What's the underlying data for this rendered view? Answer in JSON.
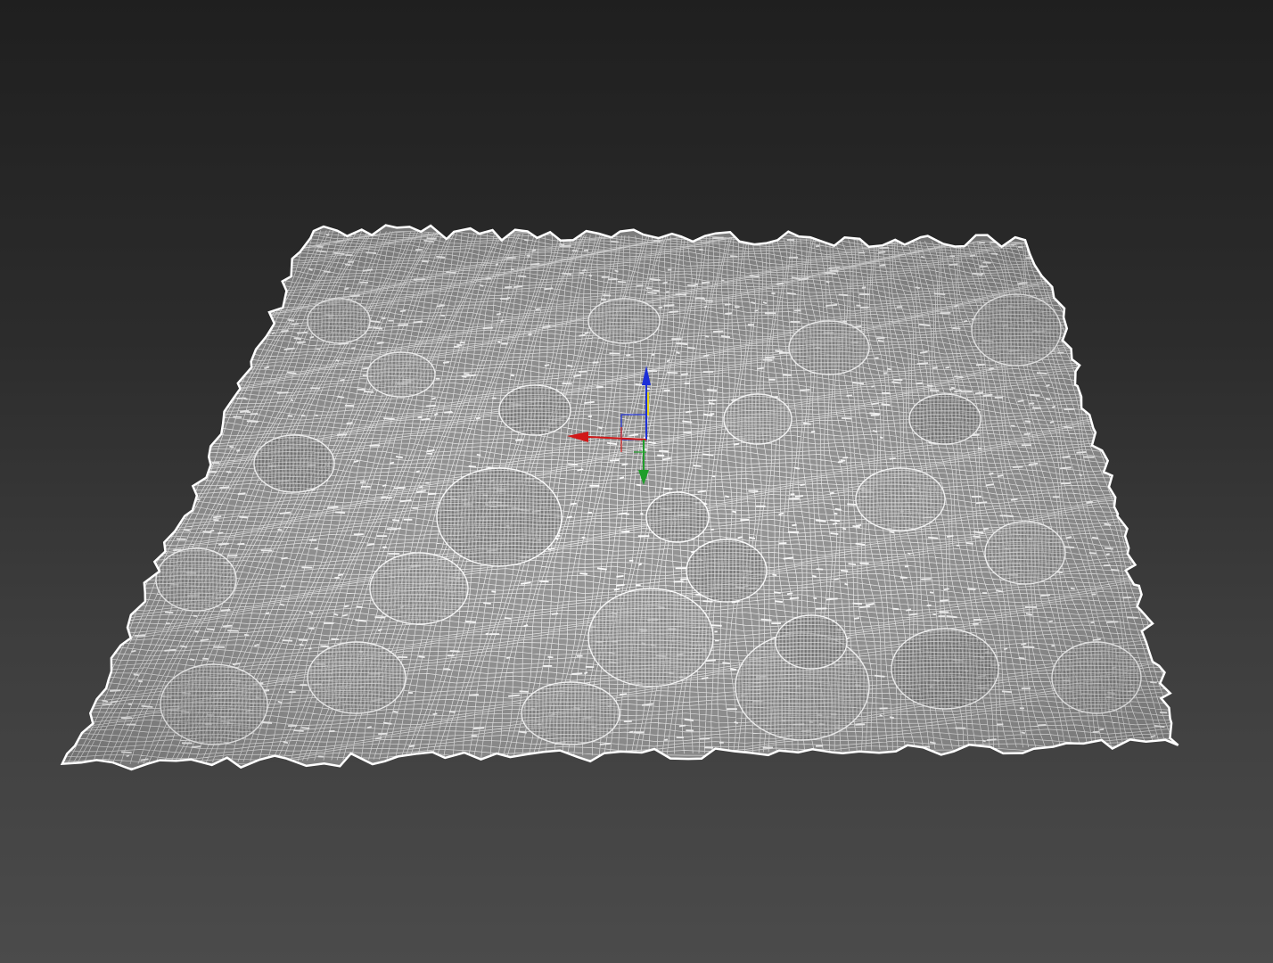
{
  "viewport": {
    "view": "perspective",
    "shading": "wireframe",
    "background_top": "#1f1f1f",
    "background_bottom": "#4b4b4b",
    "wire_color": "#ffffff",
    "mesh_fill": "#8c8c8c"
  },
  "mesh": {
    "type": "terrain-rock-ground",
    "icon": "wireframe-terrain"
  },
  "gizmo": {
    "type": "move-transform-gizmo",
    "x_axis_color": "#d01818",
    "y_axis_color": "#1f9e2a",
    "z_axis_color": "#1c2fd8",
    "plane_color": "#e2d21a"
  }
}
